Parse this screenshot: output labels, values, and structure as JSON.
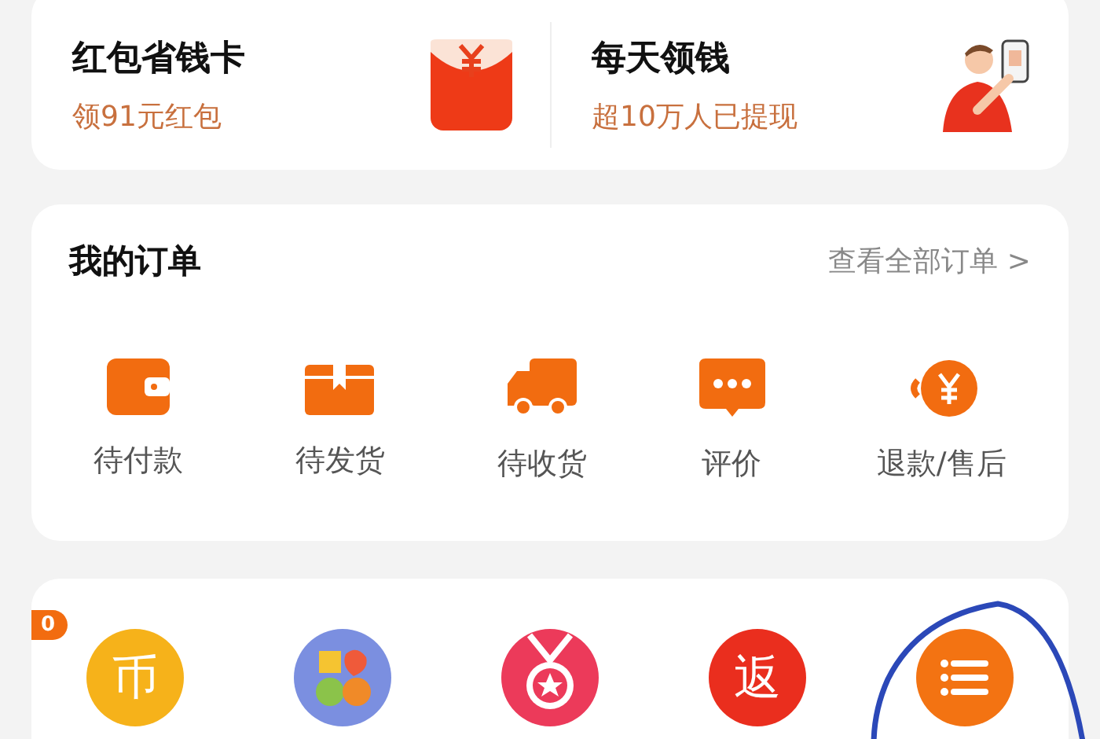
{
  "promo_cards": [
    {
      "kind": "envelope",
      "title": "红包省钱卡",
      "subtitle": "领91元红包"
    },
    {
      "kind": "person",
      "title": "每天领钱",
      "subtitle": "超10万人已提现"
    }
  ],
  "orders": {
    "title": "我的订单",
    "link": "查看全部订单 >",
    "items": [
      {
        "kind": "wallet",
        "label": "待付款"
      },
      {
        "kind": "box",
        "label": "待发货"
      },
      {
        "kind": "truck",
        "label": "待收货"
      },
      {
        "kind": "chat",
        "label": "评价"
      },
      {
        "kind": "refund",
        "label": "退款/售后"
      }
    ]
  },
  "services": {
    "badge": "0",
    "items": [
      {
        "kind": "coin",
        "glyph": "币"
      },
      {
        "kind": "shapes"
      },
      {
        "kind": "medal"
      },
      {
        "kind": "return",
        "glyph": "返"
      },
      {
        "kind": "list"
      }
    ]
  },
  "annotation": {
    "kind": "circle"
  }
}
